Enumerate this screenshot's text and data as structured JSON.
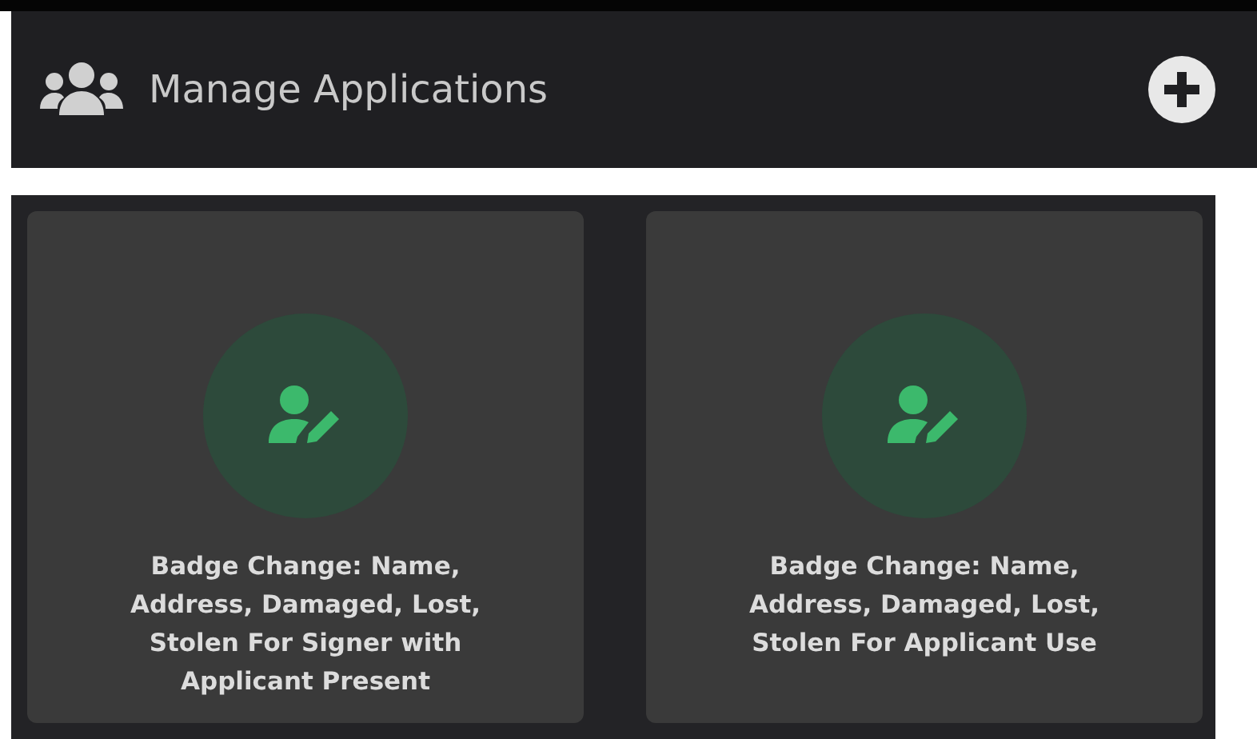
{
  "header": {
    "title": "Manage Applications"
  },
  "cards": [
    {
      "title": "Badge Change: Name, Address, Damaged, Lost, Stolen For Signer with Applicant Present"
    },
    {
      "title": "Badge Change: Name, Address, Damaged, Lost, Stolen For Applicant Use"
    }
  ]
}
